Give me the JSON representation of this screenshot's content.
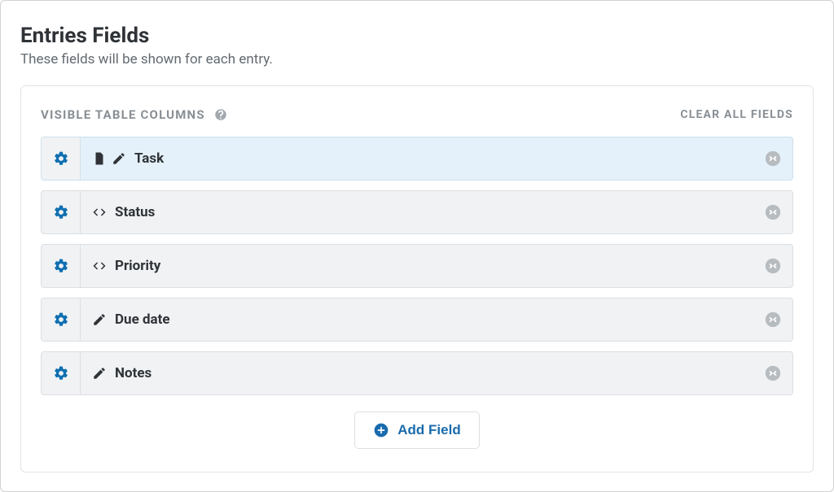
{
  "header": {
    "title": "Entries Fields",
    "subtitle": "These fields will be shown for each entry."
  },
  "card": {
    "title": "VISIBLE TABLE COLUMNS",
    "clear_label": "CLEAR ALL FIELDS",
    "add_field_label": "Add Field"
  },
  "fields": [
    {
      "label": "Task",
      "selected": true,
      "icons": [
        "file",
        "pencil"
      ]
    },
    {
      "label": "Status",
      "selected": false,
      "icons": [
        "code"
      ]
    },
    {
      "label": "Priority",
      "selected": false,
      "icons": [
        "code"
      ]
    },
    {
      "label": "Due date",
      "selected": false,
      "icons": [
        "pencil"
      ]
    },
    {
      "label": "Notes",
      "selected": false,
      "icons": [
        "pencil"
      ]
    }
  ]
}
